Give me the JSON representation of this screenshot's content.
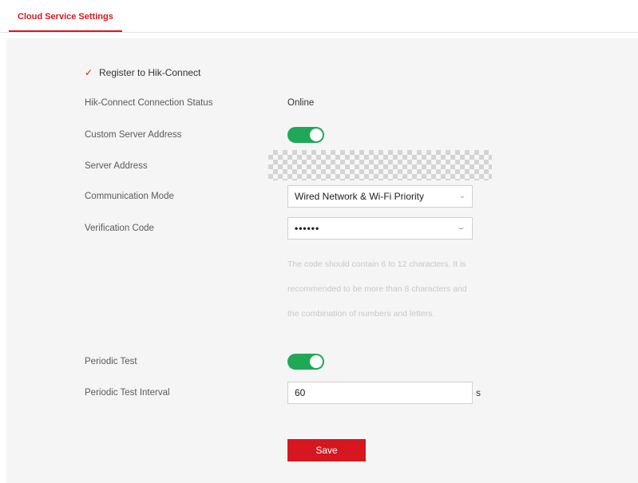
{
  "tab": {
    "label": "Cloud Service Settings"
  },
  "register": {
    "label": "Register to Hik-Connect",
    "checked": true
  },
  "connection_status": {
    "label": "Hik-Connect Connection Status",
    "value": "Online"
  },
  "custom_server": {
    "label": "Custom Server Address",
    "enabled": true
  },
  "server_address": {
    "label": "Server Address"
  },
  "communication_mode": {
    "label": "Communication Mode",
    "value": "Wired Network & Wi-Fi Priority"
  },
  "verification_code": {
    "label": "Verification Code",
    "value": "••••••"
  },
  "verification_hint": "The code should contain 6 to 12 characters. It is recommended to be more than 8 characters and the combination of numbers and letters.",
  "periodic_test": {
    "label": "Periodic Test",
    "enabled": true
  },
  "periodic_interval": {
    "label": "Periodic Test Interval",
    "value": "60",
    "unit": "s"
  },
  "save_label": "Save",
  "colors": {
    "accent": "#d7171f",
    "toggle_on": "#1fa855",
    "panel": "#f5f5f5"
  }
}
